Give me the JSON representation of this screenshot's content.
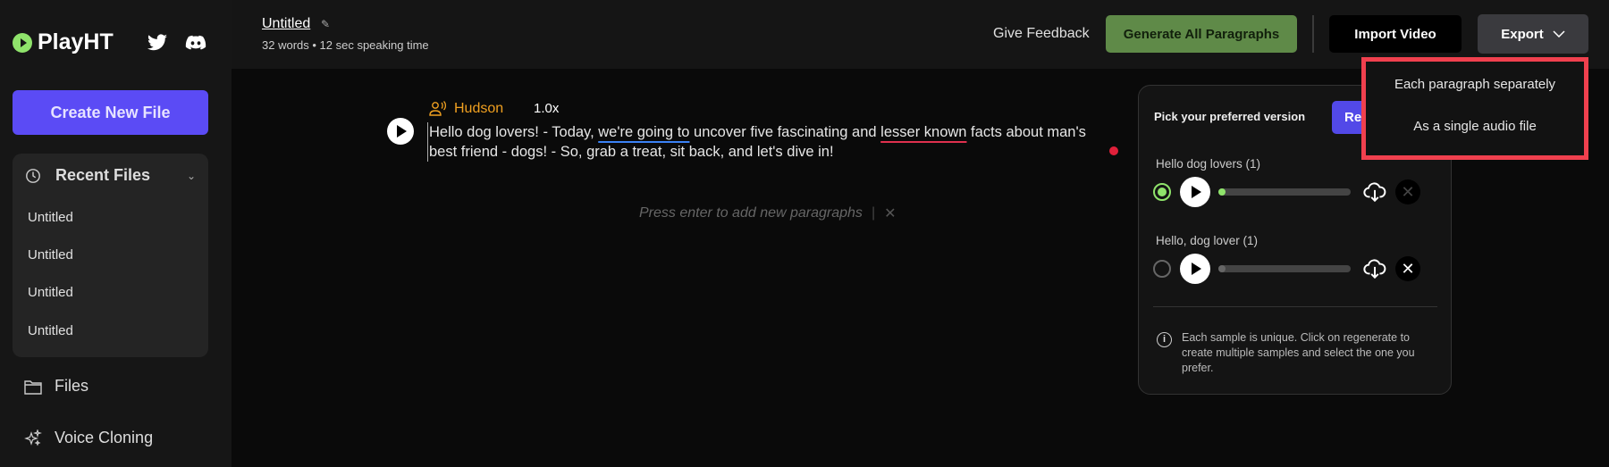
{
  "sidebar": {
    "brand": "PlayHT",
    "create_label": "Create New File",
    "recent_title": "Recent Files",
    "recent_items": [
      "Untitled",
      "Untitled",
      "Untitled",
      "Untitled"
    ],
    "nav": [
      {
        "label": "Files",
        "icon": "folder-icon"
      },
      {
        "label": "Voice Cloning",
        "icon": "sparkles-icon"
      }
    ]
  },
  "header": {
    "title": "Untitled",
    "stats": "32 words • 12 sec speaking time",
    "feedback": "Give Feedback",
    "generate": "Generate All Paragraphs",
    "import": "Import Video",
    "export": "Export"
  },
  "export_menu": [
    "Each paragraph separately",
    "As a single audio file"
  ],
  "paragraph": {
    "voice": "Hudson",
    "speed": "1.0x",
    "text_parts": [
      "Hello dog lovers! - Today, ",
      "we're going to",
      " uncover five fascinating and ",
      "lesser known",
      " facts about man's best friend - dogs! - So, grab a treat, sit back, and let's dive in!"
    ],
    "placeholder": "Press enter to add new paragraphs"
  },
  "versions": {
    "title": "Pick your preferred version",
    "regenerate": "Regenerate",
    "samples": [
      {
        "label": "Hello dog lovers (1)",
        "selected": true,
        "progress": 0
      },
      {
        "label": "Hello, dog lover (1)",
        "selected": false,
        "progress": 0
      }
    ],
    "info": "Each sample is unique. Click on regenerate to create multiple samples and select the one you prefer."
  },
  "colors": {
    "accent": "#5b4bf5",
    "brand": "#8fe36b",
    "generate": "#5f8a48",
    "highlight": "#f0404e",
    "voice": "#f0a020"
  }
}
